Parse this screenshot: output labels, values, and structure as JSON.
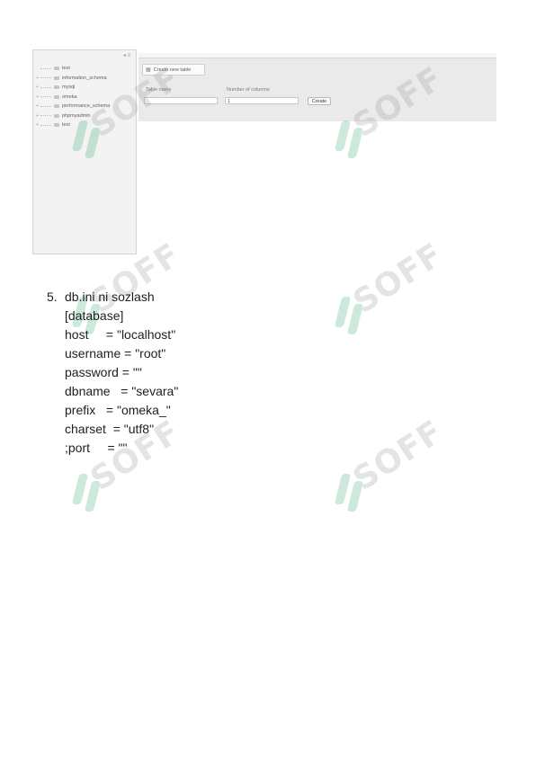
{
  "screenshot": {
    "collapse_label": "◂ ≡",
    "databases": [
      {
        "name": "test"
      },
      {
        "name": "information_schema"
      },
      {
        "name": "mysql"
      },
      {
        "name": "omeka"
      },
      {
        "name": "performance_schema"
      },
      {
        "name": "phpmyadmin"
      },
      {
        "name": "test"
      }
    ],
    "new_table_tab": "Create new table",
    "table_name_label": "Table name",
    "columns_label": "Number of columns",
    "columns_value": "1",
    "create_button": "Create"
  },
  "watermark_text": "SOFF",
  "instruction": {
    "number": "5.",
    "title": "db.ini ni sozlash",
    "lines": [
      "[database]",
      "host     = \"localhost\"",
      "username = \"root\"",
      "password = \"\"",
      "dbname   = \"sevara\"",
      "prefix   = \"omeka_\"",
      "charset  = \"utf8\"",
      ";port     = \"\""
    ]
  }
}
